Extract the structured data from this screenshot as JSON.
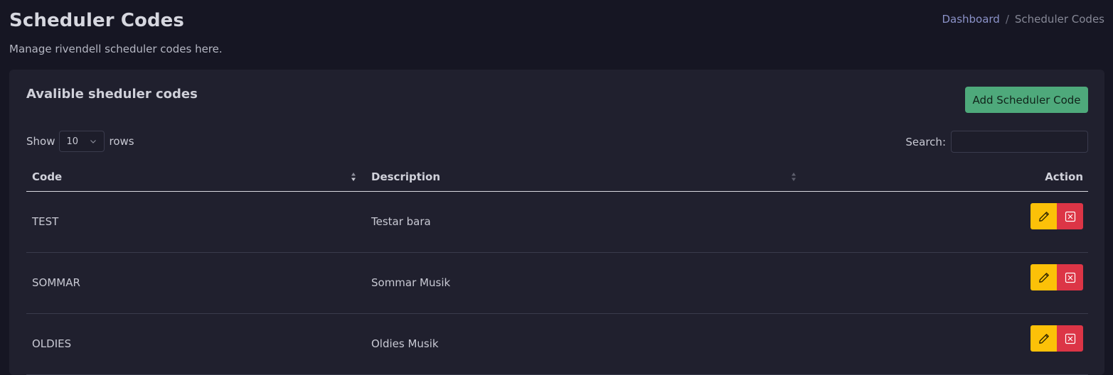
{
  "header": {
    "title": "Scheduler Codes",
    "subtitle": "Manage rivendell scheduler codes here.",
    "breadcrumb": {
      "home": "Dashboard",
      "separator": "/",
      "current": "Scheduler Codes"
    }
  },
  "card": {
    "title": "Avalible sheduler codes",
    "add_button": "Add Scheduler Code",
    "length": {
      "prefix": "Show",
      "value": "10",
      "suffix": "rows"
    },
    "search": {
      "label": "Search:",
      "value": "",
      "placeholder": ""
    }
  },
  "table": {
    "columns": {
      "code": "Code",
      "description": "Description",
      "action": "Action"
    },
    "rows": [
      {
        "code": "TEST",
        "description": "Testar bara"
      },
      {
        "code": "SOMMAR",
        "description": "Sommar Musik"
      },
      {
        "code": "OLDIES",
        "description": "Oldies Musik"
      }
    ]
  },
  "colors": {
    "background": "#161623",
    "card": "#20202e",
    "add_button": "#4ea97b",
    "edit_button": "#fcc108",
    "delete_button": "#dc3546",
    "link": "#8b92c8"
  },
  "icons": {
    "edit": "pencil-icon",
    "delete": "x-square-icon",
    "select": "chevron-down-icon",
    "sort": "sort-icon"
  }
}
